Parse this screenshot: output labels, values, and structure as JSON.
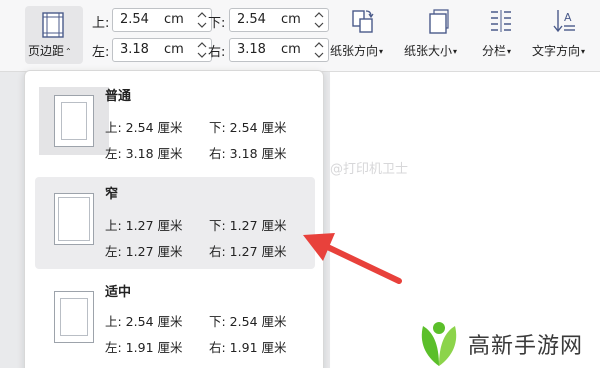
{
  "toolbar": {
    "margins_button": {
      "label": "页边距",
      "icon": "page-margins-icon"
    },
    "fields": {
      "top": {
        "label": "上:",
        "value": "2.54",
        "unit": "cm"
      },
      "bottom": {
        "label": "下:",
        "value": "2.54",
        "unit": "cm"
      },
      "left": {
        "label": "左:",
        "value": "3.18",
        "unit": "cm"
      },
      "right": {
        "label": "右:",
        "value": "3.18",
        "unit": "cm"
      }
    },
    "buttons": [
      {
        "label": "纸张方向",
        "icon": "orientation-icon"
      },
      {
        "label": "纸张大小",
        "icon": "paper-size-icon"
      },
      {
        "label": "分栏",
        "icon": "columns-icon"
      },
      {
        "label": "文字方向",
        "icon": "text-direction-icon"
      }
    ]
  },
  "presets": [
    {
      "title": "普通",
      "top": "上: 2.54 厘米",
      "bottom": "下: 2.54 厘米",
      "left": "左: 3.18 厘米",
      "right": "右: 3.18 厘米"
    },
    {
      "title": "窄",
      "top": "上: 1.27 厘米",
      "bottom": "下: 1.27 厘米",
      "left": "左: 1.27 厘米",
      "right": "右: 1.27 厘米"
    },
    {
      "title": "适中",
      "top": "上: 2.54 厘米",
      "bottom": "下: 2.54 厘米",
      "left": "左: 1.91 厘米",
      "right": "右: 1.91 厘米"
    }
  ],
  "watermark": "@打印机卫士",
  "site_logo": {
    "text": "高新手游网",
    "icon": "leaf-logo-icon"
  },
  "colors": {
    "arrow": "#e8413b",
    "logo_green": "#5bbf2a",
    "hover_bg": "#ececee"
  }
}
